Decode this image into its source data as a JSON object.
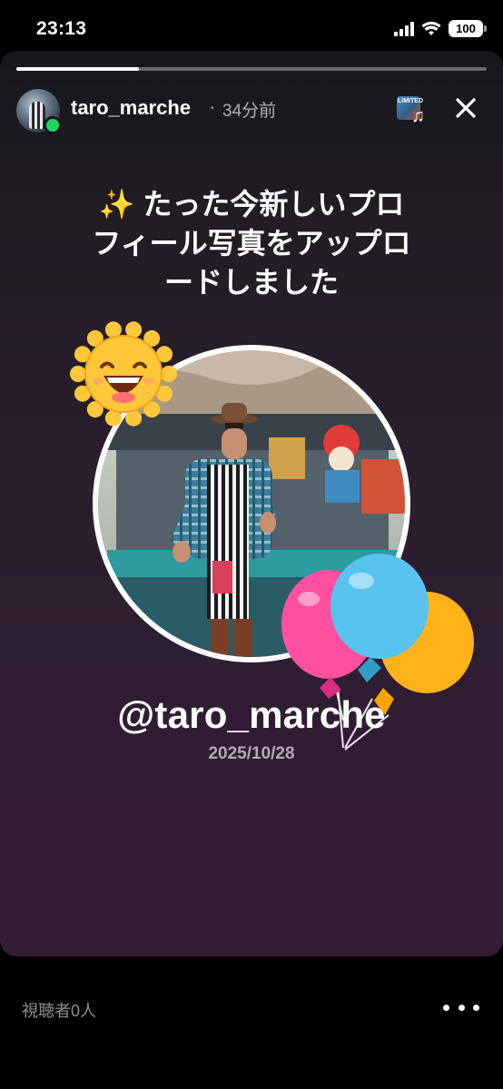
{
  "status_bar": {
    "time": "23:13",
    "battery": "100",
    "icons": [
      "signal-icon",
      "wifi-icon",
      "battery-icon"
    ]
  },
  "story": {
    "progress_fraction": 0.26,
    "user": {
      "username": "taro_marche",
      "separator": "·",
      "posted_ago": "34分前",
      "online": true
    },
    "music": {
      "cover_label": "LIMITED",
      "icon": "music-note-icon"
    },
    "close_icon": "close-icon",
    "headline": {
      "sparkle": "✨",
      "lines": [
        "たった今新しいプロ",
        "フィール写真をアップロ",
        "ードしました"
      ]
    },
    "stickers": [
      "sun-sticker",
      "balloons-sticker"
    ],
    "handle": "@taro_marche",
    "date": "2025/10/28"
  },
  "footer": {
    "viewers": "視聴者0人",
    "more_icon": "more-icon"
  },
  "colors": {
    "online": "#1ed760",
    "background_top": "#17161c",
    "background_bottom": "#341c35",
    "balloon_pink": "#ff4fa0",
    "balloon_blue": "#58c3ee",
    "balloon_yellow": "#ffb21a",
    "sun": "#ffc83a"
  }
}
